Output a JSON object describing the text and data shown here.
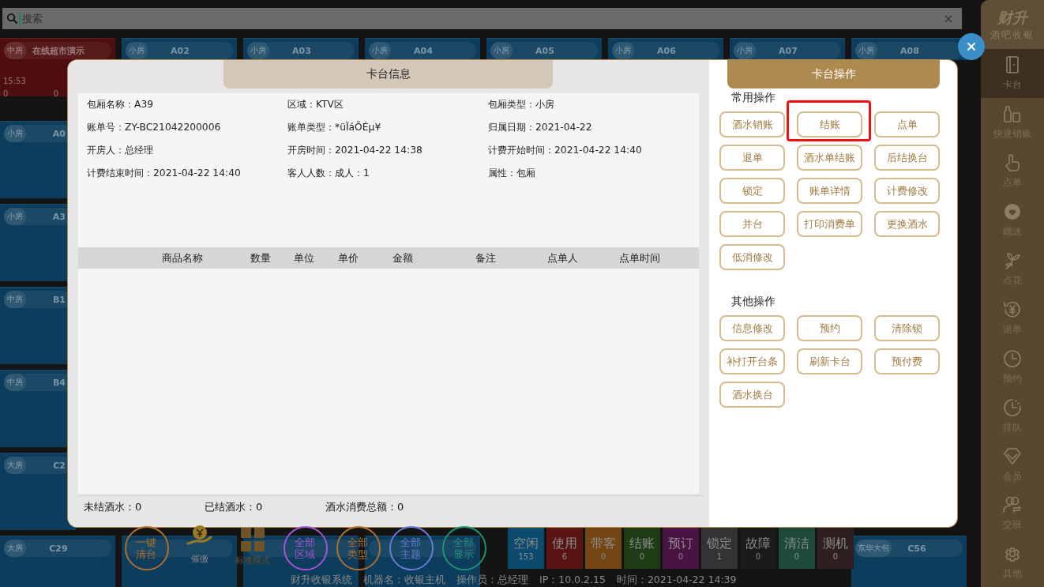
{
  "search": {
    "placeholder": "搜索"
  },
  "rooms": {
    "top_row": [
      {
        "badge": "中房",
        "name": "在线超市演示",
        "color": "#4e0d0e",
        "time": "15:53",
        "figures": [
          "0",
          "0"
        ]
      },
      {
        "badge": "小房",
        "name": "A02",
        "color": "#0d3d5c"
      },
      {
        "badge": "小房",
        "name": "A03",
        "color": "#0d3d5c"
      },
      {
        "badge": "小房",
        "name": "A04",
        "color": "#0d3d5c"
      },
      {
        "badge": "小房",
        "name": "A05",
        "color": "#0d3d5c"
      },
      {
        "badge": "小房",
        "name": "A06",
        "color": "#0d3d5c"
      },
      {
        "badge": "小房",
        "name": "A07",
        "color": "#0d3d5c"
      },
      {
        "badge": "小房",
        "name": "A08",
        "color": "#0d3d5c"
      }
    ],
    "left_column": [
      {
        "badge": "小房",
        "name": "A0",
        "color": "#0d3d5c"
      },
      {
        "badge": "小房",
        "name": "A3",
        "color": "#0d3d5c"
      },
      {
        "badge": "中房",
        "name": "B1",
        "color": "#0d3d5c"
      },
      {
        "badge": "中房",
        "name": "B4",
        "color": "#0d3d5c"
      },
      {
        "badge": "大房",
        "name": "C2",
        "color": "#0d3d5c"
      }
    ],
    "bottom_row": [
      {
        "badge": "大房",
        "name": "C29",
        "color": "#0d3d5c"
      },
      {
        "color": "#0d3d5c"
      },
      {
        "color": "#0d3d5c"
      },
      {
        "color": "#0d3d5c"
      },
      {
        "badge": "东华大包",
        "name": "C56",
        "color": "#0d3d5c"
      }
    ]
  },
  "modal": {
    "info_tab": "卡台信息",
    "fields": [
      "包厢名称：A39",
      "区域：KTV区",
      "包厢类型：小房",
      "账单号：ZY-BC21042200006",
      "账单类型：*üÏáÕÉµ¥",
      "归属日期：2021-04-22",
      "开房人：总经理",
      "开房时间：2021-04-22 14:38",
      "计费开始时间：2021-04-22 14:40",
      "计费结束时间：2021-04-22 14:40",
      "客人人数：成人：1",
      "属性：包厢"
    ],
    "table": {
      "columns": [
        "商品名称",
        "数量",
        "单位",
        "单价",
        "金额",
        "备注",
        "点单人",
        "点单时间"
      ]
    },
    "totals": [
      "未结酒水：0",
      "已结酒水：0",
      "酒水消费总额：0"
    ],
    "ops_tab": "卡台操作",
    "sections": [
      {
        "title": "常用操作",
        "buttons": [
          {
            "label": "酒水销账",
            "highlighted": false
          },
          {
            "label": "结账",
            "highlighted": true
          },
          {
            "label": "点单",
            "highlighted": false
          },
          {
            "label": "退单",
            "highlighted": false
          },
          {
            "label": "酒水单结账",
            "highlighted": false
          },
          {
            "label": "后结换台",
            "highlighted": false
          },
          {
            "label": "锁定",
            "highlighted": false
          },
          {
            "label": "账单详情",
            "highlighted": false
          },
          {
            "label": "计费修改",
            "highlighted": false
          },
          {
            "label": "并台",
            "highlighted": false
          },
          {
            "label": "打印消费单",
            "highlighted": false
          },
          {
            "label": "更换酒水",
            "highlighted": false
          },
          {
            "label": "低消修改",
            "highlighted": false
          }
        ]
      },
      {
        "title": "其他操作",
        "buttons": [
          {
            "label": "信息修改",
            "highlighted": false
          },
          {
            "label": "预约",
            "highlighted": false
          },
          {
            "label": "清除锁",
            "highlighted": false
          },
          {
            "label": "补打开台条",
            "highlighted": false
          },
          {
            "label": "刷新卡台",
            "highlighted": false
          },
          {
            "label": "预付费",
            "highlighted": false
          },
          {
            "label": "酒水换台",
            "highlighted": false
          }
        ]
      }
    ]
  },
  "sidebar": {
    "logo": "财升",
    "subtitle": "酒吧收银",
    "items": [
      {
        "label": "卡台",
        "selected": true
      },
      {
        "label": "快速销账",
        "selected": false
      },
      {
        "label": "点单",
        "selected": false
      },
      {
        "label": "赠送",
        "selected": false
      },
      {
        "label": "点花",
        "selected": false
      },
      {
        "label": "退单",
        "selected": false
      },
      {
        "label": "预约",
        "selected": false
      },
      {
        "label": "排队",
        "selected": false
      },
      {
        "label": "会员",
        "selected": false
      },
      {
        "label": "交班",
        "selected": false
      },
      {
        "label": "其他",
        "selected": false
      }
    ]
  },
  "dock": {
    "actions": [
      {
        "label": "一键清台",
        "kind": "circle",
        "color": "#b0702c"
      },
      {
        "label": "催缴",
        "kind": "icon"
      },
      {
        "label": "标准模式",
        "kind": "icon"
      },
      {
        "label": "全部区域",
        "kind": "circle",
        "color": "#a455d4"
      },
      {
        "label": "全部类型",
        "kind": "circle",
        "color": "#b0702c"
      },
      {
        "label": "全部主题",
        "kind": "circle",
        "color": "#6a7ad8"
      },
      {
        "label": "全部显示",
        "kind": "circle",
        "color": "#20927a"
      }
    ],
    "legend": [
      {
        "label": "空闲",
        "count": "153",
        "color": "#0c4a6e"
      },
      {
        "label": "使用",
        "count": "6",
        "color": "#5a1414"
      },
      {
        "label": "带客",
        "count": "0",
        "color": "#744614"
      },
      {
        "label": "结账",
        "count": "0",
        "color": "#1e3c16"
      },
      {
        "label": "预订",
        "count": "0",
        "color": "#4a1442"
      },
      {
        "label": "锁定",
        "count": "1",
        "color": "#333333"
      },
      {
        "label": "故障",
        "count": "0",
        "color": "#1a1a1a"
      },
      {
        "label": "清洁",
        "count": "0",
        "color": "#1e4a3a"
      },
      {
        "label": "测机",
        "count": "0",
        "color": "#2e2020"
      }
    ]
  },
  "status_bar": [
    "财升收银系统",
    "机器名：收银主机",
    "操作员：总经理",
    "IP：10.0.2.15",
    "时间：2021-04-22 14:39"
  ]
}
